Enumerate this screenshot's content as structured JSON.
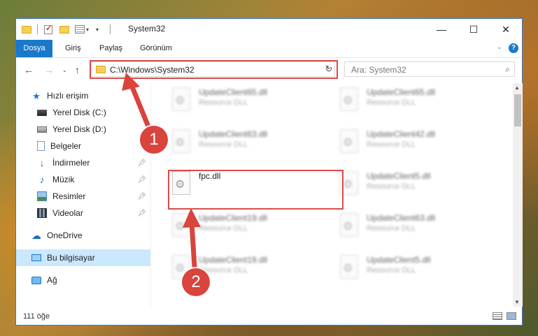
{
  "window": {
    "title": "System32",
    "controls": {
      "minimize": "—",
      "maximize": "☐",
      "close": "✕"
    }
  },
  "ribbon": {
    "tabs": [
      "Dosya",
      "Giriş",
      "Paylaş",
      "Görünüm"
    ]
  },
  "nav": {
    "address": "C:\\Windows\\System32",
    "search_placeholder": "Ara: System32"
  },
  "sidebar": {
    "items": [
      {
        "label": "Hızlı erişim",
        "icon": "star-icon"
      },
      {
        "label": "Yerel Disk (C:)",
        "icon": "drive-icon"
      },
      {
        "label": "Yerel Disk (D:)",
        "icon": "drive-icon"
      },
      {
        "label": "Belgeler",
        "icon": "document-icon"
      },
      {
        "label": "İndirmeler",
        "icon": "download-icon"
      },
      {
        "label": "Müzik",
        "icon": "music-icon"
      },
      {
        "label": "Resimler",
        "icon": "pictures-icon"
      },
      {
        "label": "Videolar",
        "icon": "videos-icon"
      },
      {
        "label": "OneDrive",
        "icon": "cloud-icon"
      },
      {
        "label": "Bu bilgisayar",
        "icon": "computer-icon"
      },
      {
        "label": "Ağ",
        "icon": "network-icon"
      }
    ]
  },
  "files": [
    {
      "name": "UpdateClient65.dll",
      "type": "Resource DLL"
    },
    {
      "name": "UpdateClient65.dll",
      "type": "Resource DLL"
    },
    {
      "name": "UpdateClient63.dll",
      "type": "Resource DLL"
    },
    {
      "name": "UpdateClient42.dll",
      "type": "Resource DLL"
    },
    {
      "name": "fpc.dll",
      "type": ""
    },
    {
      "name": "UpdateClient5.dll",
      "type": "Resource DLL"
    },
    {
      "name": "UpdateClient19.dll",
      "type": "Resource DLL"
    },
    {
      "name": "UpdateClient63.dll",
      "type": "Resource DLL"
    },
    {
      "name": "UpdateClient19.dll",
      "type": "Resource DLL"
    },
    {
      "name": "UpdateClient5.dll",
      "type": "Resource DLL"
    }
  ],
  "status": {
    "count": "111 öğe"
  },
  "callouts": [
    "1",
    "2"
  ],
  "colors": {
    "accent": "#1979ca",
    "highlight": "#d94c4c",
    "selection": "#cce8ff"
  }
}
